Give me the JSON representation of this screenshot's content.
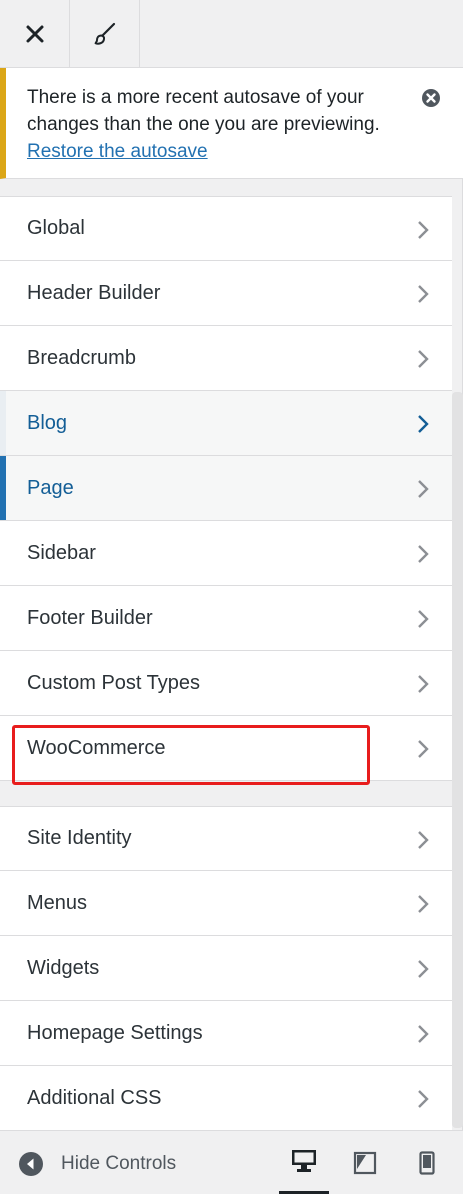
{
  "toolbar": {
    "close_icon": "close-icon",
    "customize_icon": "paintbrush-icon"
  },
  "notice": {
    "message": "There is a more recent autosave of your changes than the one you are previewing.",
    "link": "Restore the autosave",
    "accent_color": "#dba617"
  },
  "theme_sections": [
    {
      "label": "Global"
    },
    {
      "label": "Header Builder"
    },
    {
      "label": "Breadcrumb"
    },
    {
      "label": "Blog"
    },
    {
      "label": "Page"
    },
    {
      "label": "Sidebar"
    },
    {
      "label": "Footer Builder"
    },
    {
      "label": "Custom Post Types"
    },
    {
      "label": "WooCommerce"
    }
  ],
  "core_sections": [
    {
      "label": "Site Identity"
    },
    {
      "label": "Menus"
    },
    {
      "label": "Widgets"
    },
    {
      "label": "Homepage Settings"
    },
    {
      "label": "Additional CSS"
    }
  ],
  "footer": {
    "hide_controls_label": "Hide Controls",
    "devices": [
      "desktop",
      "tablet",
      "mobile"
    ],
    "active_device": "desktop"
  },
  "colors": {
    "link": "#2271b1",
    "current_accent": "#2271b1",
    "highlight_box": "#e81d1d"
  }
}
